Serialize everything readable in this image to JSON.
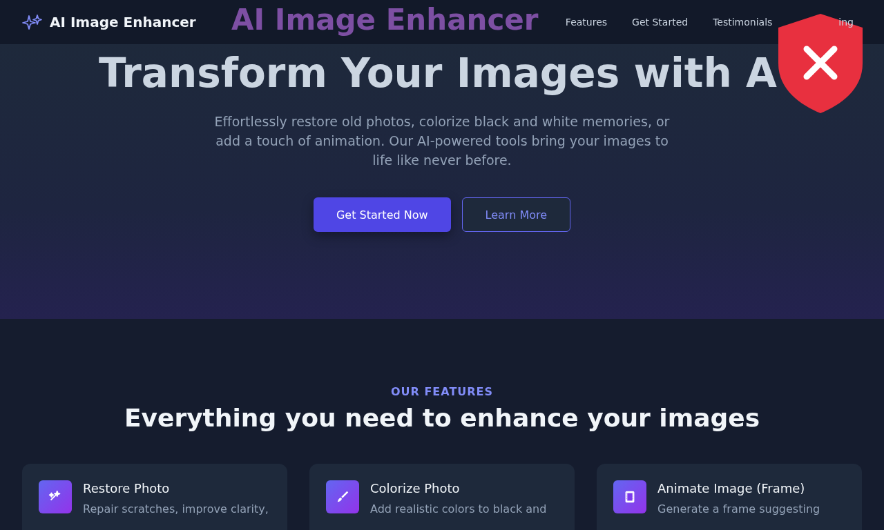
{
  "header": {
    "brand": "AI Image Enhancer",
    "nav": [
      "Features",
      "Get Started",
      "Testimonials",
      "ing"
    ]
  },
  "hero": {
    "backdrop_title": "AI Image Enhancer",
    "title": "Transform Your Images with A",
    "subtitle": "Effortlessly restore old photos, colorize black and white memories, or add a touch of animation. Our AI-powered tools bring your images to life like never before.",
    "buttons": [
      {
        "label": "Get Started Now",
        "kind": "primary"
      },
      {
        "label": "Learn More",
        "kind": "outline"
      }
    ]
  },
  "features": {
    "eyebrow": "OUR FEATURES",
    "title": "Everything you need to enhance your images",
    "cards": [
      {
        "title": "Restore Photo",
        "description": "Repair scratches, improve clarity,"
      },
      {
        "title": "Colorize Photo",
        "description": "Add realistic colors to black and"
      },
      {
        "title": "Animate Image (Frame)",
        "description": "Generate a frame suggesting"
      }
    ]
  }
}
